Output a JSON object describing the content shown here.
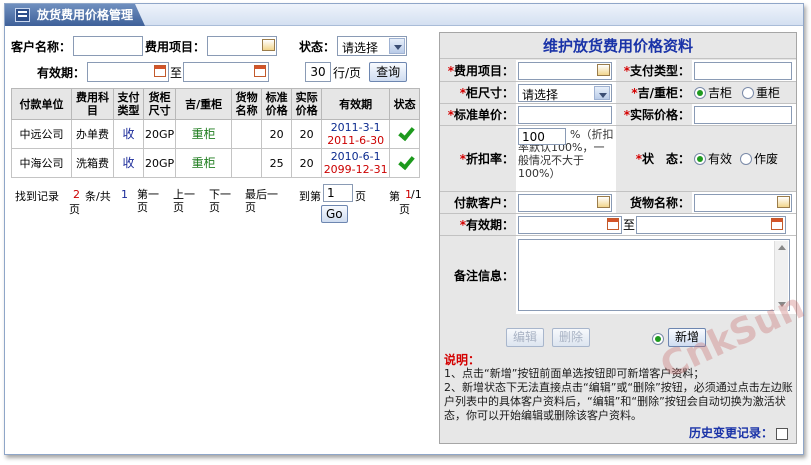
{
  "window": {
    "title": "放货费用价格管理"
  },
  "search": {
    "customer_label": "客户名称：",
    "customer_value": "",
    "fee_item_label": "费用项目：",
    "fee_item_value": "",
    "status_label": "状态：",
    "status_value": "请选择",
    "valid_label": "有效期：",
    "valid_from": "",
    "to_label": "至",
    "valid_to": "",
    "page_size": "30",
    "per_page_label": "行/页",
    "query_button": "查询"
  },
  "table": {
    "headers": [
      "付款单位",
      "费用科目",
      "支付类型",
      "货柜尺寸",
      "吉/重柜",
      "货物名称",
      "标准价格",
      "实际价格",
      "有效期",
      "状态"
    ],
    "rows": [
      {
        "payer": "中远公司",
        "fee": "办单费",
        "pay_type": "收",
        "size": "20GP",
        "cabinet": "重柜",
        "goods": "",
        "std_price": "20",
        "real_price": "20",
        "date_start": "2011-3-1",
        "date_end": "2011-6-30"
      },
      {
        "payer": "中海公司",
        "fee": "洗箱费",
        "pay_type": "收",
        "size": "20GP",
        "cabinet": "重柜",
        "goods": "",
        "std_price": "25",
        "real_price": "20",
        "date_start": "2010-6-1",
        "date_end": "2099-12-31"
      }
    ]
  },
  "pager": {
    "found_label": "找到记录",
    "record_count": "2",
    "record_unit": "条/共",
    "page_total": "1",
    "page_unit": "页",
    "first": "第一页",
    "prev": "上一页",
    "next": "下一页",
    "last": "最后一页",
    "goto_label": "到第",
    "goto_value": "1",
    "goto_unit": "页",
    "go_button": "Go",
    "current_prefix": "第",
    "current": "1",
    "slash_total": "/1",
    "current_unit": "页"
  },
  "form": {
    "title": "维护放货费用价格资料",
    "fee_item_label": "费用项目：",
    "pay_type_label": "支付类型：",
    "size_label": "柜尺寸：",
    "size_value": "请选择",
    "cabinet_label": "吉/重柜：",
    "cabinet_opt1": "吉柜",
    "cabinet_opt2": "重柜",
    "std_price_label": "标准单价：",
    "real_price_label": "实际价格：",
    "discount_label": "折扣率：",
    "discount_value": "100",
    "discount_note": "%（折扣率默认100%，一般情况不大于100%）",
    "status_label": "状　态：",
    "status_opt1": "有效",
    "status_opt2": "作废",
    "payer_label": "付款客户：",
    "goods_label": "货物名称：",
    "valid_label": "有效期：",
    "to_label": "至",
    "remark_label": "备注信息：",
    "edit_button": "编辑",
    "delete_button": "删除",
    "add_label": "新增"
  },
  "explain": {
    "head": "说明：",
    "line1": "1、点击“新增”按钮前面单选按钮即可新增客户资料；",
    "line2": "2、新增状态下无法直接点击“编辑”或“删除”按钮，必须通过点击左边账户列表中的具体客户资料后，“编辑”和“删除”按钮会自动切换为激活状态，你可以开始编辑或删除该客户资料。"
  },
  "history": {
    "label": "历史变更记录："
  },
  "watermark": "CnkSun"
}
